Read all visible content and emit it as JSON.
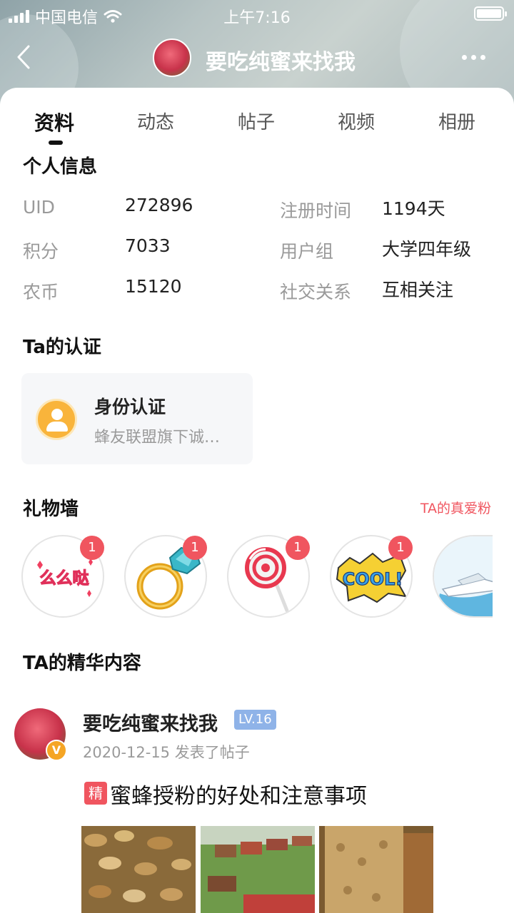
{
  "status_bar": {
    "carrier": "中国电信",
    "time": "上午7:16"
  },
  "nav": {
    "title": "要吃纯蜜来找我"
  },
  "tabs": [
    {
      "label": "资料",
      "active": true
    },
    {
      "label": "动态"
    },
    {
      "label": "帖子"
    },
    {
      "label": "视频"
    },
    {
      "label": "相册"
    }
  ],
  "personal_info": {
    "title": "个人信息",
    "rows": [
      {
        "label": "UID",
        "value": "272896"
      },
      {
        "label": "积分",
        "value": "7033"
      },
      {
        "label": "农币",
        "value": "15120"
      },
      {
        "label": "注册时间",
        "value": "1194天"
      },
      {
        "label": "用户组",
        "value": "大学四年级"
      },
      {
        "label": "社交关系",
        "value": "互相关注"
      }
    ]
  },
  "certification": {
    "title": "Ta的认证",
    "card_title": "身份认证",
    "card_desc": "蜂友联盟旗下诚…"
  },
  "gift_wall": {
    "title": "礼物墙",
    "fans_link": "TA的真爱粉",
    "gifts": [
      {
        "icon": "kiss-text-icon",
        "count": "1",
        "text": "么么哒"
      },
      {
        "icon": "diamond-ring-icon",
        "count": "1"
      },
      {
        "icon": "lollipop-icon",
        "count": "1"
      },
      {
        "icon": "cool-sticker-icon",
        "count": "1",
        "text": "COOL!"
      },
      {
        "icon": "yacht-icon"
      }
    ]
  },
  "featured": {
    "title": "TA的精华内容",
    "post": {
      "author": "要吃纯蜜来找我",
      "level": "LV.16",
      "verified_mark": "V",
      "date": "2020-12-15 发表了帖子",
      "tag": "精",
      "title": "蜜蜂授粉的好处和注意事项",
      "images": [
        "bees-photo",
        "beehives-photo",
        "honeycomb-photo"
      ]
    }
  },
  "colors": {
    "accent_red": "#f0555f",
    "level_blue": "#8fb3e8",
    "cert_orange": "#f9b43b"
  }
}
